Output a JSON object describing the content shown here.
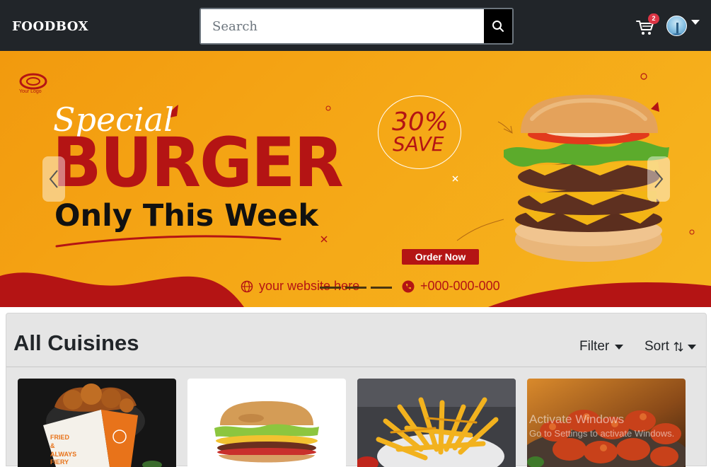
{
  "navbar": {
    "brand": "FOODBOX",
    "search_placeholder": "Search",
    "cart_count": "2"
  },
  "banner": {
    "logo_text": "Your Logo",
    "special": "Special",
    "headline": "BURGER",
    "subheadline": "Only This Week",
    "discount": "30%",
    "save": "SAVE",
    "order_button": "Order Now",
    "website": "your website here",
    "phone": "+000-000-000",
    "colors": {
      "background": "#f5a716",
      "accent": "#b41414"
    }
  },
  "cuisines": {
    "title": "All Cuisines",
    "filter_label": "Filter",
    "sort_label": "Sort",
    "cards": [
      {
        "name": "fried-chicken-box",
        "box_text": "FRIED & ALWAYS FIERY"
      },
      {
        "name": "burger"
      },
      {
        "name": "french-fries"
      },
      {
        "name": "chicken-wings"
      }
    ]
  },
  "watermark": {
    "line1": "Activate Windows",
    "line2": "Go to Settings to activate Windows."
  }
}
